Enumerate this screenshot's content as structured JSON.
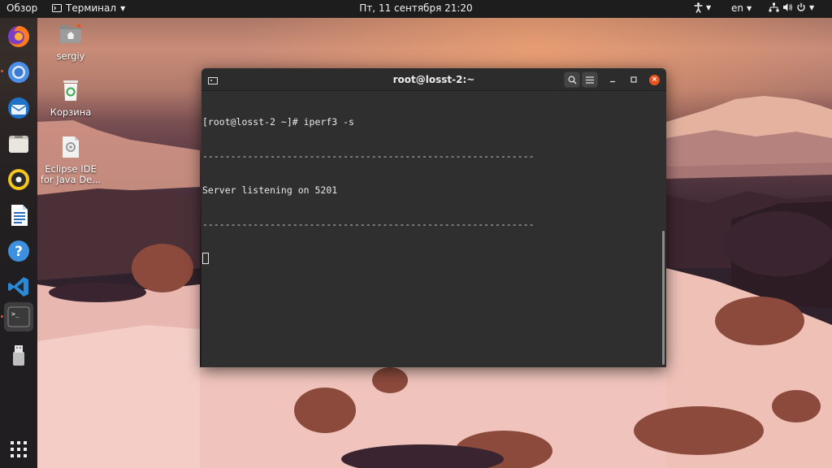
{
  "topbar": {
    "activities": "Обзор",
    "app_menu": "Терминал",
    "clock": "Пт, 11 сентября  21:20",
    "language": "en"
  },
  "dock": {
    "items": [
      {
        "name": "Firefox",
        "icon": "firefox-icon"
      },
      {
        "name": "Chromium",
        "icon": "chromium-icon",
        "running": true
      },
      {
        "name": "Thunderbird",
        "icon": "thunderbird-icon"
      },
      {
        "name": "Files",
        "icon": "files-icon"
      },
      {
        "name": "Rhythmbox",
        "icon": "rhythmbox-icon"
      },
      {
        "name": "LibreOffice Writer",
        "icon": "writer-icon"
      },
      {
        "name": "Help",
        "icon": "help-icon"
      },
      {
        "name": "VS Code",
        "icon": "vscode-icon"
      },
      {
        "name": "Terminal",
        "icon": "terminal-icon",
        "running": true,
        "active": true
      },
      {
        "name": "USB drive",
        "icon": "usb-icon"
      }
    ],
    "show_apps_icon": "grid-icon"
  },
  "desktop": {
    "icons": [
      {
        "label": "sergiy",
        "icon": "home-folder-icon"
      },
      {
        "label": "Корзина",
        "icon": "trash-icon"
      },
      {
        "label": "Eclipse IDE for Java De...",
        "icon": "eclipse-icon"
      }
    ]
  },
  "terminal": {
    "title": "root@losst-2:~",
    "lines": [
      "[root@losst-2 ~]# iperf3 -s",
      "-----------------------------------------------------------",
      "Server listening on 5201",
      "-----------------------------------------------------------"
    ]
  },
  "colors": {
    "accent": "#e95420",
    "topbar": "#1d1d1d",
    "terminal_bg": "#2f2f2f"
  }
}
